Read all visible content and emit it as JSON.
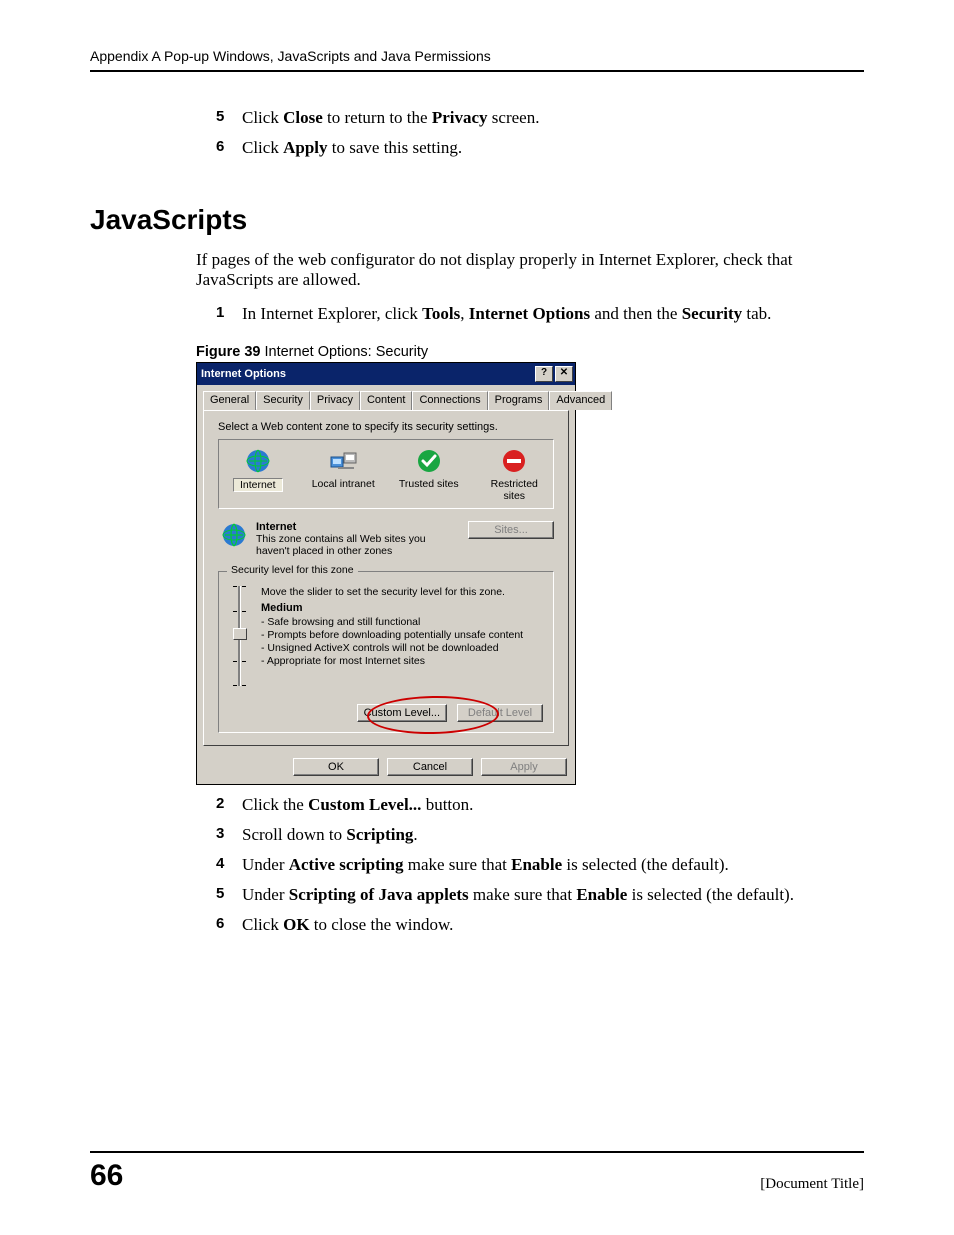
{
  "header": "Appendix A Pop-up Windows, JavaScripts and Java Permissions",
  "topSteps": [
    {
      "num": "5",
      "pre": "Click ",
      "b1": "Close",
      "mid": " to return to the ",
      "b2": "Privacy",
      "post": " screen."
    },
    {
      "num": "6",
      "pre": "Click ",
      "b1": "Apply",
      "mid": " to save this setting.",
      "b2": "",
      "post": ""
    }
  ],
  "sectionHeading": "JavaScripts",
  "intro": "If pages of the web configurator do not display properly in Internet Explorer, check that JavaScripts are allowed.",
  "step1": {
    "num": "1",
    "pre": "In Internet Explorer, click ",
    "b1": "Tools",
    "sep1": ", ",
    "b2": "Internet Options",
    "sep2": " and then the ",
    "b3": "Security",
    "post": " tab."
  },
  "figure": {
    "label": "Figure 39",
    "caption": "   Internet Options: Security"
  },
  "dialog": {
    "title": "Internet Options",
    "helpGlyph": "?",
    "closeGlyph": "✕",
    "tabs": [
      "General",
      "Security",
      "Privacy",
      "Content",
      "Connections",
      "Programs",
      "Advanced"
    ],
    "activeTab": 1,
    "selectZoneText": "Select a Web content zone to specify its security settings.",
    "zones": [
      {
        "label": "Internet",
        "selected": true
      },
      {
        "label": "Local intranet",
        "selected": false
      },
      {
        "label": "Trusted sites",
        "selected": false
      },
      {
        "label": "Restricted sites",
        "selected": false
      }
    ],
    "zoneName": "Internet",
    "zoneInfo": "This zone contains all Web sites you haven't placed in other zones",
    "sitesBtn": "Sites...",
    "groupLegend": "Security level for this zone",
    "moveSliderText": "Move the slider to set the security level for this zone.",
    "levelName": "Medium",
    "bullets": [
      "- Safe browsing and still functional",
      "- Prompts before downloading potentially unsafe content",
      "- Unsigned ActiveX controls will not be downloaded",
      "- Appropriate for most Internet sites"
    ],
    "customLevelBtn": "Custom Level...",
    "defaultLevelBtn": "Default Level",
    "okBtn": "OK",
    "cancelBtn": "Cancel",
    "applyBtn": "Apply"
  },
  "bottomSteps": [
    {
      "num": "2",
      "html": "Click the <b>Custom Level...</b> button."
    },
    {
      "num": "3",
      "html": "Scroll down to <b>Scripting</b>."
    },
    {
      "num": "4",
      "html": "Under <b>Active scripting</b> make sure that <b>Enable</b> is selected (the default)."
    },
    {
      "num": "5",
      "html": "Under <b>Scripting of Java applets</b> make sure that <b>Enable</b> is selected (the default)."
    },
    {
      "num": "6",
      "html": "Click <b>OK</b> to close the window."
    }
  ],
  "footer": {
    "pageNumber": "66",
    "docTitle": "[Document Title]"
  }
}
